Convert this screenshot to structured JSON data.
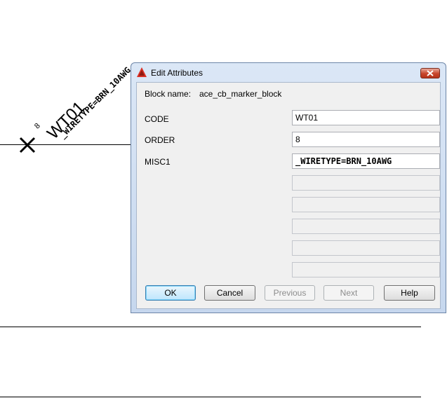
{
  "drawing": {
    "marker_seq": "8",
    "marker_code": "WT01",
    "marker_wiretype": "_WIRETYPE=BRN_10AWG"
  },
  "dialog": {
    "title": "Edit Attributes",
    "block_name_label": "Block name:",
    "block_name_value": "ace_cb_marker_block",
    "attributes": [
      {
        "label": "CODE",
        "value": "WT01"
      },
      {
        "label": "ORDER",
        "value": "8"
      },
      {
        "label": "MISC1",
        "value": "_WIRETYPE=BRN_10AWG"
      }
    ],
    "buttons": {
      "ok": "OK",
      "cancel": "Cancel",
      "previous": "Previous",
      "next": "Next",
      "help": "Help"
    }
  },
  "colors": {
    "close_button": "#c7452b",
    "app_icon": "#d93025"
  }
}
